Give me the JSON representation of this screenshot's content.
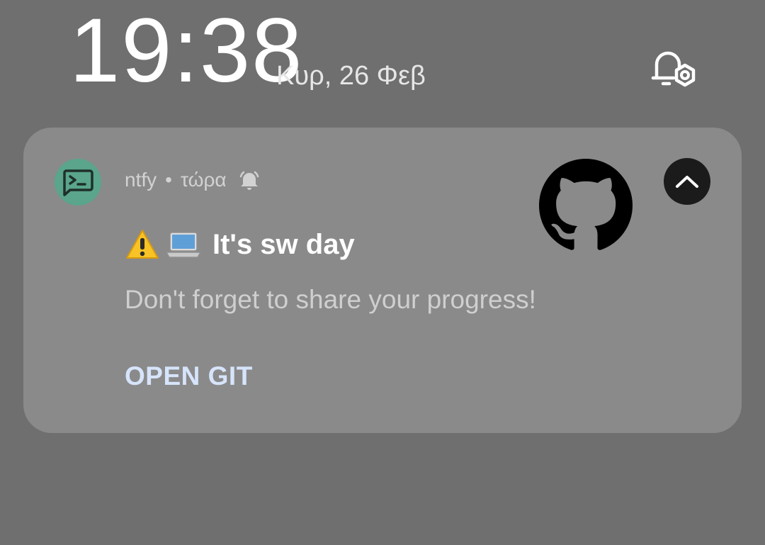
{
  "statusbar": {
    "time": "19:38",
    "date": "Κυρ, 26 Φεβ",
    "alarm_settings_icon": "alarm-settings-icon"
  },
  "notification": {
    "app_icon": "terminal-icon",
    "app_icon_color": "#5aa58c",
    "app_name": "ntfy",
    "separator": "•",
    "time": "τώρα",
    "bell_icon": "bell-icon",
    "large_icon": "github-icon",
    "collapse_icon": "chevron-up-icon",
    "title_emojis": [
      "warning-emoji",
      "laptop-emoji"
    ],
    "title": "It's sw day",
    "message": "Don't forget to share your progress!",
    "action_label": "OPEN GIT",
    "action_color": "#d6e4fb",
    "card_color": "#8a8a8a"
  }
}
